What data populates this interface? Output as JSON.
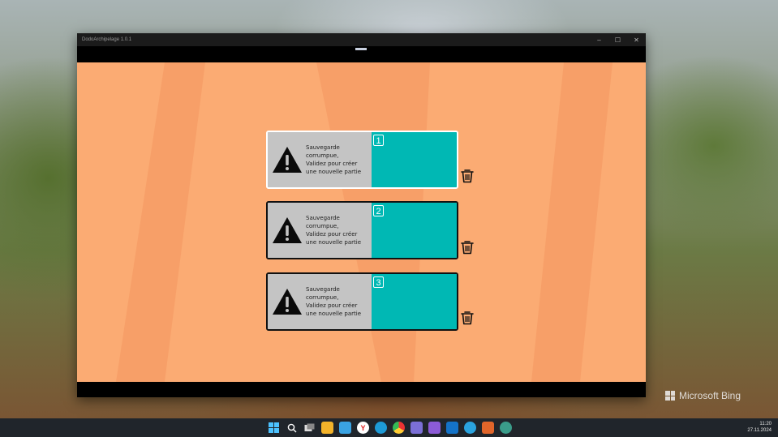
{
  "window": {
    "title": "DodoArchipelage 1.0.1",
    "minimize_glyph": "–",
    "maximize_glyph": "☐",
    "close_glyph": "✕"
  },
  "slots": [
    {
      "number": "1",
      "line1": "Sauvegarde corrumpue,",
      "line2": "Validez pour créer",
      "line3": "une nouvelle partie",
      "selected": true
    },
    {
      "number": "2",
      "line1": "Sauvegarde corrumpue,",
      "line2": "Validez pour créer",
      "line3": "une nouvelle partie",
      "selected": false
    },
    {
      "number": "3",
      "line1": "Sauvegarde corrumpue,",
      "line2": "Validez pour créer",
      "line3": "une nouvelle partie",
      "selected": false
    }
  ],
  "desktop": {
    "watermark": "Microsoft Bing"
  },
  "taskbar": {
    "time": "11:20",
    "date": "27.11.2024",
    "icons": [
      "windows-start-icon",
      "search-icon",
      "task-view-icon",
      "file-explorer-icon",
      "notepad-icon",
      "yandex-browser-icon",
      "edge-icon",
      "chrome-icon",
      "save-app-icon",
      "visual-studio-icon",
      "outlook-icon",
      "telegram-icon",
      "game-app-icon",
      "globe-app-icon"
    ]
  },
  "colors": {
    "game_background": "#fbab73",
    "slot_teal": "#00b8b4",
    "slot_grey": "#c4c4c4"
  }
}
